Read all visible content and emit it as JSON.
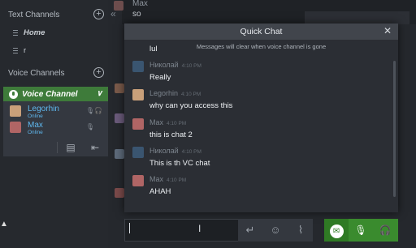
{
  "sidebar": {
    "text_channels_label": "Text Channels",
    "text_channels": [
      {
        "label": "Home"
      },
      {
        "label": "r"
      }
    ],
    "voice_channels_label": "Voice Channels",
    "voice_channel": {
      "label": "Voice Channel",
      "members": [
        {
          "name": "Legorhin",
          "status": "Online"
        },
        {
          "name": "Max",
          "status": "Online"
        }
      ]
    }
  },
  "background_chat": {
    "name": "Max",
    "preview": "so"
  },
  "quick_chat": {
    "title": "Quick Chat",
    "notice": "Messages will clear when voice channel is gone",
    "partial_message": "lul",
    "messages": [
      {
        "user": "Николай",
        "time": "4:10 PM",
        "text": "Really"
      },
      {
        "user": "Legorhin",
        "time": "4:10 PM",
        "text": "why can you access this"
      },
      {
        "user": "Max",
        "time": "4:10 PM",
        "text": "this is chat 2"
      },
      {
        "user": "Николай",
        "time": "4:10 PM",
        "text": "This is th VC chat"
      },
      {
        "user": "Max",
        "time": "4:10 PM",
        "text": "AHAH"
      }
    ]
  },
  "icons": {
    "plus": "plus-circle-icon",
    "close": "close-icon",
    "send": "enter-icon",
    "emoji": "emoji-icon",
    "attach": "paperclip-icon",
    "chat": "chat-bubble-icon",
    "mic": "microphone-icon",
    "headphones": "headphones-icon"
  },
  "colors": {
    "voice_active": "#3e7b3a",
    "username": "#5fb8ef",
    "green_controls": "#3a8b2e"
  }
}
